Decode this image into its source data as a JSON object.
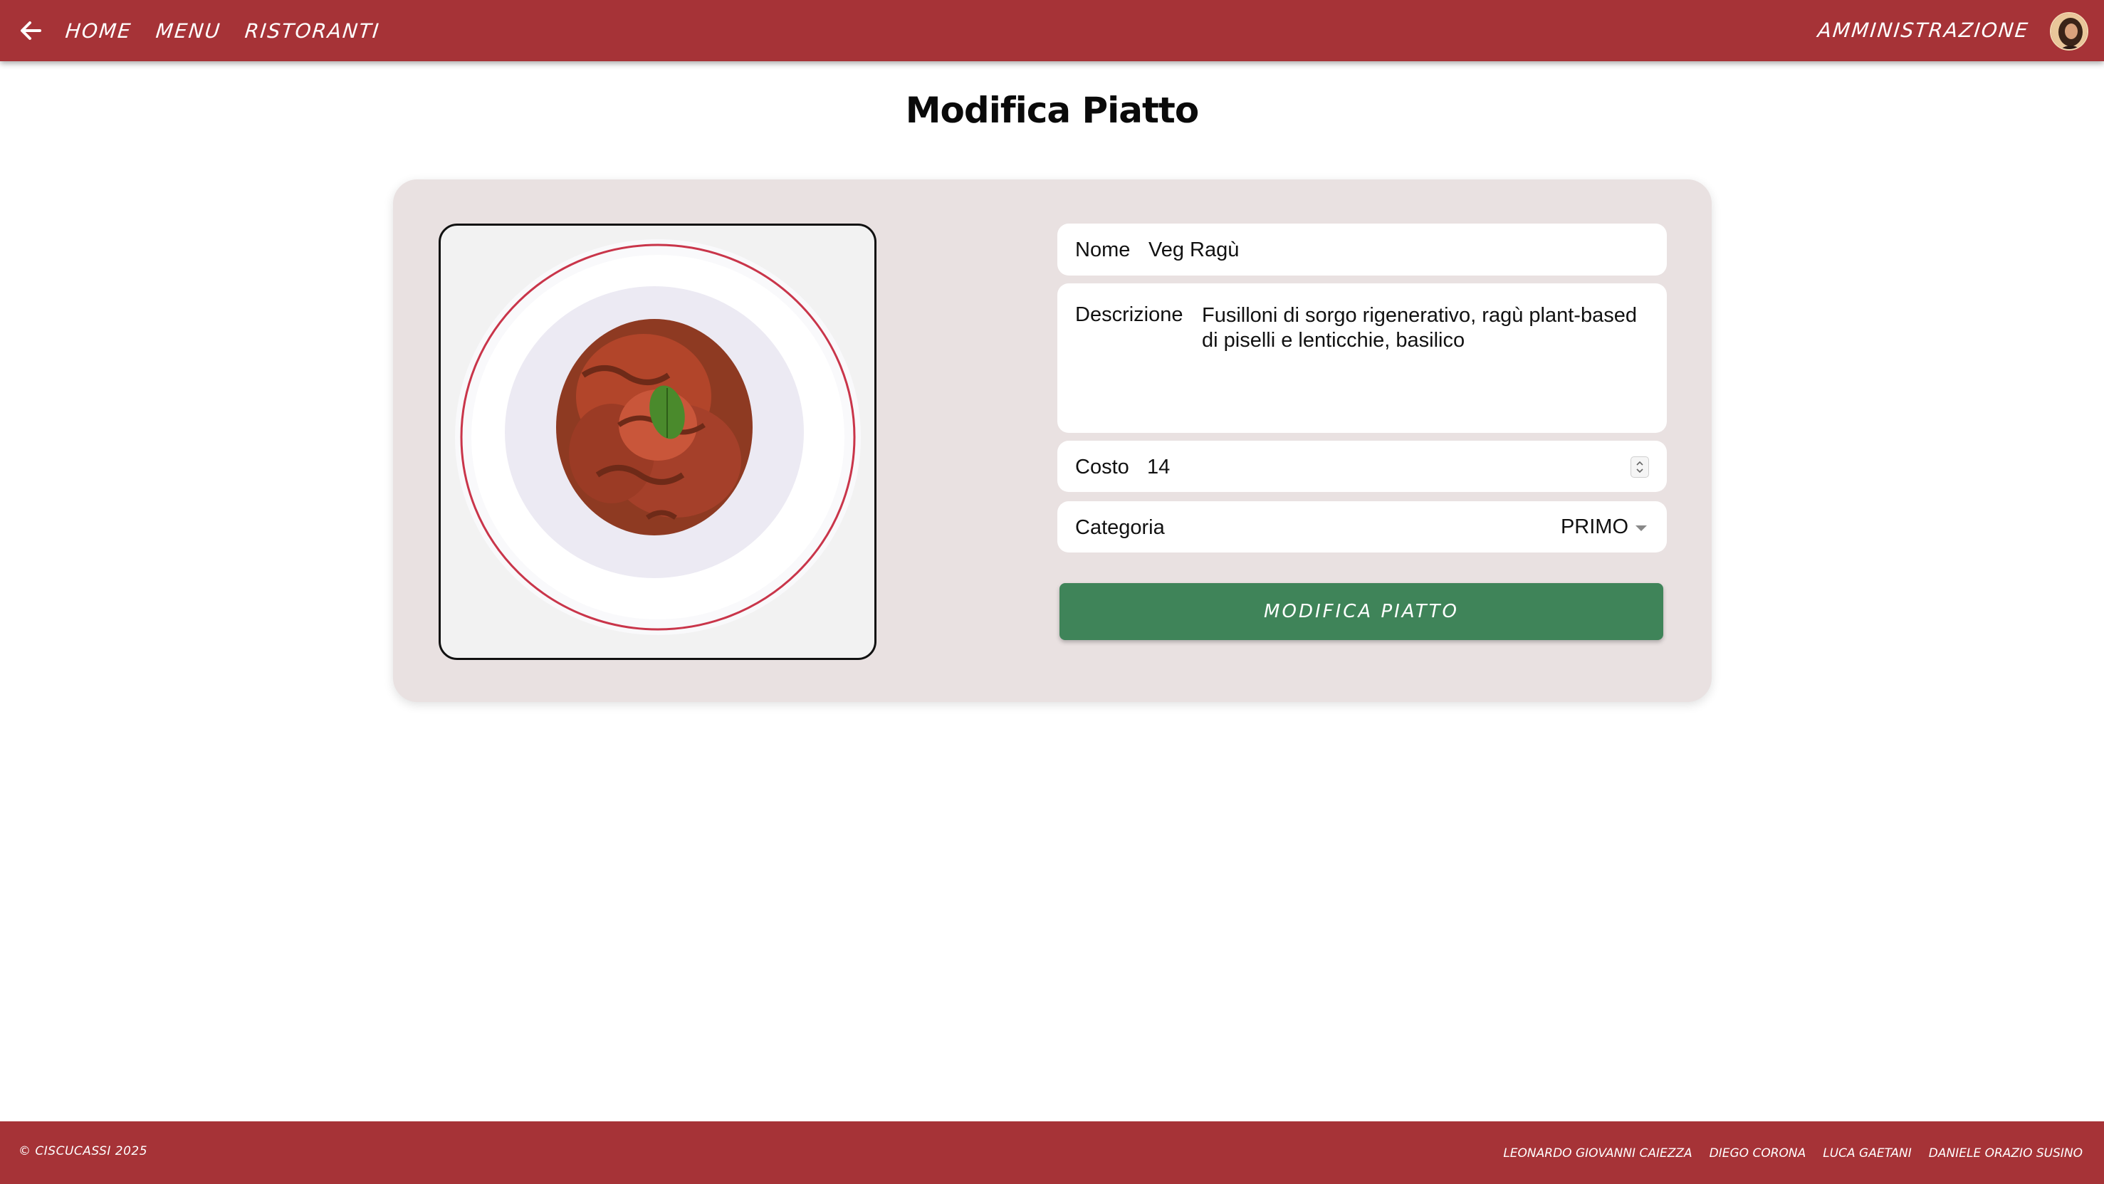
{
  "navbar": {
    "back_icon": "arrow-left-icon",
    "links": [
      "HOME",
      "MENU",
      "RISTORANTI"
    ],
    "admin_label": "AMMINISTRAZIONE",
    "avatar_icon": "user-avatar",
    "background": "#a63337"
  },
  "page": {
    "title": "Modifica Piatto"
  },
  "form": {
    "image_alt": "dish-photo",
    "nome": {
      "label": "Nome",
      "value": "Veg Ragù"
    },
    "descrizione": {
      "label": "Descrizione",
      "value": "Fusilloni di sorgo rigenerativo, ragù plant-based di piselli e lenticchie, basilico"
    },
    "costo": {
      "label": "Costo",
      "value": "14"
    },
    "categoria": {
      "label": "Categoria",
      "value": "PRIMO"
    },
    "submit_label": "MODIFICA PIATTO",
    "submit_color": "#3f8459",
    "card_color": "#e9e1e1"
  },
  "footer": {
    "copyright": "© CISCUCASSI 2025",
    "authors": [
      "LEONARDO GIOVANNI CAIEZZA",
      "DIEGO CORONA",
      "LUCA GAETANI",
      "DANIELE ORAZIO SUSINO"
    ]
  }
}
